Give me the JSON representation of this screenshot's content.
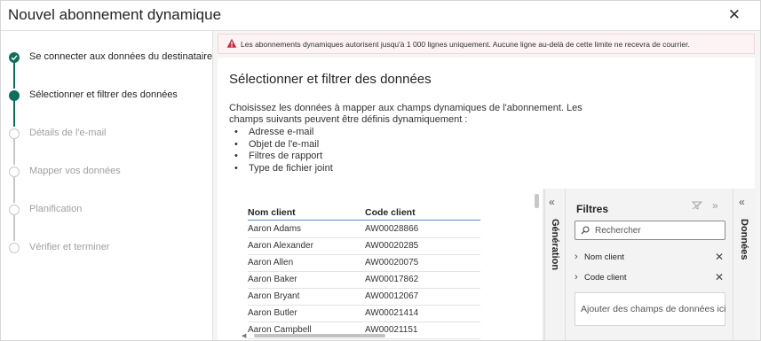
{
  "dialog": {
    "title": "Nouvel abonnement dynamique",
    "close_label": "✕"
  },
  "colors": {
    "accent": "#0e6e5a",
    "warning_bg": "#fdf3f4",
    "warning_icon": "#c4314b",
    "table_rule": "#4a8fd0"
  },
  "steps": [
    {
      "label": "Se connecter aux données du destinataire",
      "state": "done"
    },
    {
      "label": "Sélectionner et filtrer des données",
      "state": "current"
    },
    {
      "label": "Détails de l'e-mail",
      "state": "todo"
    },
    {
      "label": "Mapper vos données",
      "state": "todo"
    },
    {
      "label": "Planification",
      "state": "todo"
    },
    {
      "label": "Vérifier et terminer",
      "state": "todo"
    }
  ],
  "warning": {
    "icon": "warning-icon",
    "text": "Les abonnements dynamiques autorisent jusqu'à 1 000 lignes uniquement. Aucune ligne au-delà de cette limite ne recevra de courrier."
  },
  "main": {
    "heading": "Sélectionner et filtrer des données",
    "description": "Choisissez les données à mapper aux champs dynamiques de l'abonnement. Les champs suivants peuvent être définis dynamiquement :",
    "bullets": [
      "Adresse e-mail",
      "Objet de l'e-mail",
      "Filtres de rapport",
      "Type de fichier joint"
    ]
  },
  "table": {
    "columns": [
      "Nom client",
      "Code client"
    ],
    "rows": [
      [
        "Aaron Adams",
        "AW00028866"
      ],
      [
        "Aaron Alexander",
        "AW00020285"
      ],
      [
        "Aaron Allen",
        "AW00020075"
      ],
      [
        "Aaron Baker",
        "AW00017862"
      ],
      [
        "Aaron Bryant",
        "AW00012067"
      ],
      [
        "Aaron Butler",
        "AW00021414"
      ],
      [
        "Aaron Campbell",
        "AW00021151"
      ]
    ]
  },
  "panes": {
    "generation_label": "Génération",
    "data_label": "Données",
    "filters_title": "Filtres",
    "search_placeholder": "Rechercher",
    "filter_items": [
      "Nom client",
      "Code client"
    ],
    "add_fields_placeholder": "Ajouter des champs de données ici"
  }
}
